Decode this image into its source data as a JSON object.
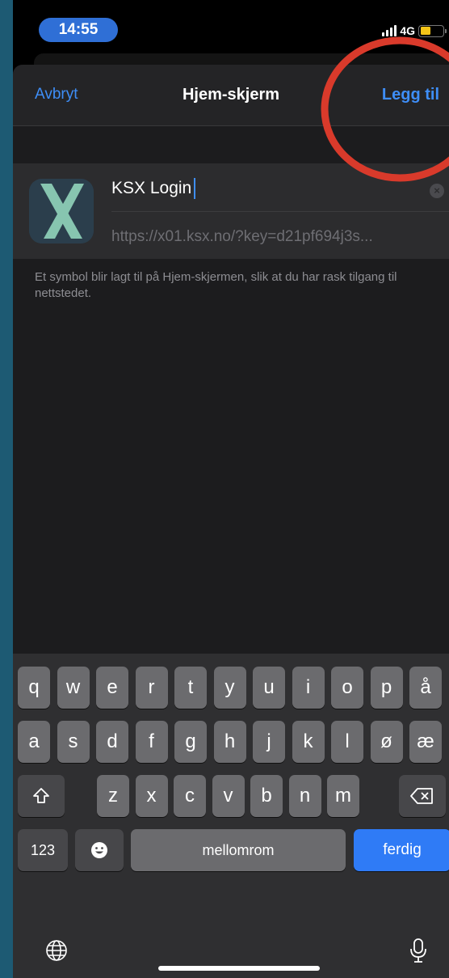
{
  "status_bar": {
    "time": "14:55",
    "network": "4G",
    "battery_color": "#f5c518"
  },
  "navbar": {
    "cancel": "Avbryt",
    "title": "Hjem-skjerm",
    "add": "Legg til"
  },
  "form": {
    "name": "KSX Login",
    "url": "https://x01.ksx.no/?key=d21pf694j3s...",
    "help": "Et symbol blir lagt til på Hjem-skjermen, slik at du har rask tilgang til nettstedet."
  },
  "keyboard": {
    "row1": [
      "q",
      "w",
      "e",
      "r",
      "t",
      "y",
      "u",
      "i",
      "o",
      "p",
      "å"
    ],
    "row2": [
      "a",
      "s",
      "d",
      "f",
      "g",
      "h",
      "j",
      "k",
      "l",
      "ø",
      "æ"
    ],
    "row3": [
      "z",
      "x",
      "c",
      "v",
      "b",
      "n",
      "m"
    ],
    "numbers_key": "123",
    "space_key": "mellomrom",
    "done_key": "ferdig",
    "icons": [
      "shift-icon",
      "backspace-icon",
      "emoji-icon",
      "globe-icon",
      "microphone-icon"
    ]
  },
  "annotation_color": "#d93a2b",
  "accent_color": "#3e8ef7"
}
